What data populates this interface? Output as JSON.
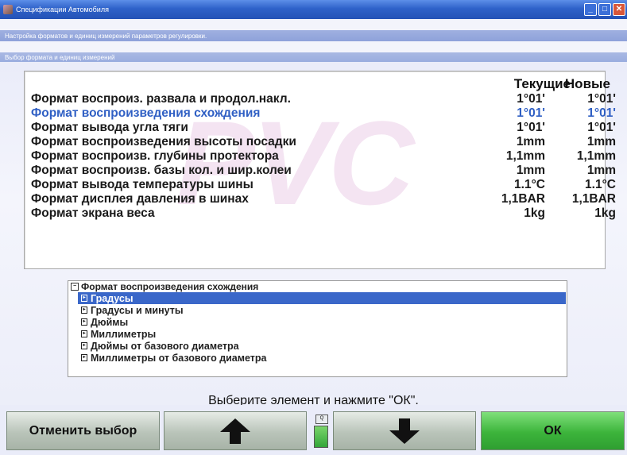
{
  "window": {
    "title": "Спецификации Автомобиля",
    "min": "_",
    "max": "□",
    "close": "✕"
  },
  "subheaders": {
    "line1": "Настройка форматов и единиц измерений параметров регулировки.",
    "line2": "Выбор формата и единиц измерений"
  },
  "watermark": "PVC",
  "table": {
    "col_current": "Текущие",
    "col_new": "Новые",
    "rows": [
      {
        "label": "Формат воспроиз. развала и продол.накл.",
        "current": "1°01'",
        "new": "1°01'"
      },
      {
        "label": "Формат воспроизведения схождения",
        "current": "1°01'",
        "new": "1°01'",
        "selected": true
      },
      {
        "label": "Формат вывода угла тяги",
        "current": "1°01'",
        "new": "1°01'"
      },
      {
        "label": "Формат воспроизведения высоты посадки",
        "current": "1mm",
        "new": "1mm"
      },
      {
        "label": "Формат воспроизв. глубины протектора",
        "current": "1,1mm",
        "new": "1,1mm"
      },
      {
        "label": "Формат воспроизв. базы кол. и шир.колеи",
        "current": "1mm",
        "new": "1mm"
      },
      {
        "label": "Формат вывода температуры шины",
        "current": "1.1°C",
        "new": "1.1°C"
      },
      {
        "label": "Формат дисплея давления в шинах",
        "current": "1,1BAR",
        "new": "1,1BAR"
      },
      {
        "label": "Формат экрана веса",
        "current": "1kg",
        "new": "1kg"
      }
    ]
  },
  "options": {
    "header": "Формат воспроизведения схождения",
    "items": [
      {
        "label": "Градусы",
        "selected": true
      },
      {
        "label": "Градусы и минуты"
      },
      {
        "label": "Дюймы"
      },
      {
        "label": "Миллиметры"
      },
      {
        "label": "Дюймы от базового диаметра"
      },
      {
        "label": "Миллиметры от базового диаметра"
      }
    ]
  },
  "prompt": "Выберите элемент и нажмите \"ОК\".",
  "footer": {
    "cancel_label": "Отменить выбор",
    "ok_label": "ОК",
    "indicator_label": "Q"
  }
}
